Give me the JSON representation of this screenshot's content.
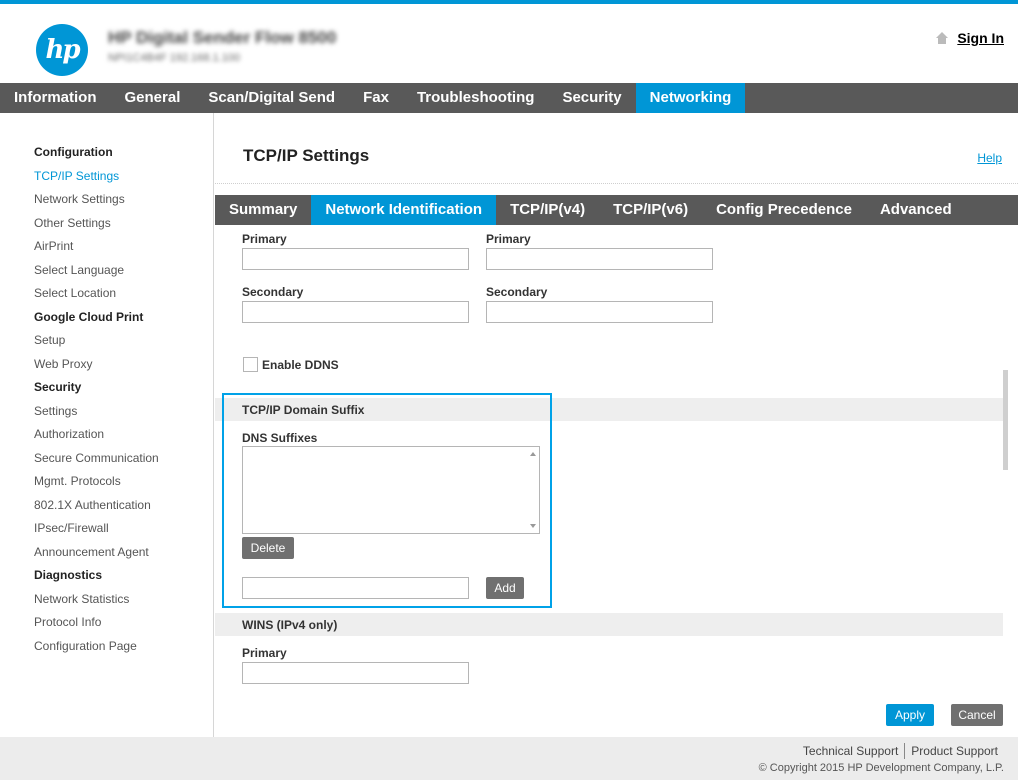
{
  "header": {
    "logo_text": "hp",
    "device_name": "HP Digital Sender Flow 8500",
    "device_subtitle": "NPI1C4B4F  192.168.1.100",
    "sign_in": "Sign In"
  },
  "main_nav": [
    {
      "label": "Information",
      "active": false
    },
    {
      "label": "General",
      "active": false
    },
    {
      "label": "Scan/Digital Send",
      "active": false
    },
    {
      "label": "Fax",
      "active": false
    },
    {
      "label": "Troubleshooting",
      "active": false
    },
    {
      "label": "Security",
      "active": false
    },
    {
      "label": "Networking",
      "active": true
    }
  ],
  "sidebar": {
    "configuration": {
      "heading": "Configuration",
      "items": [
        "TCP/IP Settings",
        "Network Settings",
        "Other Settings",
        "AirPrint",
        "Select Language",
        "Select Location"
      ]
    },
    "google_cloud_print": {
      "heading": "Google Cloud Print",
      "items": [
        "Setup",
        "Web Proxy"
      ]
    },
    "security": {
      "heading": "Security",
      "items": [
        "Settings",
        "Authorization",
        "Secure Communication",
        "Mgmt. Protocols",
        "802.1X Authentication",
        "IPsec/Firewall",
        "Announcement Agent"
      ]
    },
    "diagnostics": {
      "heading": "Diagnostics",
      "items": [
        "Network Statistics",
        "Protocol Info",
        "Configuration Page"
      ]
    }
  },
  "content": {
    "title": "TCP/IP Settings",
    "help": "Help",
    "tabs": [
      {
        "label": "Summary",
        "active": false
      },
      {
        "label": "Network Identification",
        "active": true
      },
      {
        "label": "TCP/IP(v4)",
        "active": false
      },
      {
        "label": "TCP/IP(v6)",
        "active": false
      },
      {
        "label": "Config Precedence",
        "active": false
      },
      {
        "label": "Advanced",
        "active": false
      }
    ],
    "dns": {
      "primary_label": "Primary",
      "secondary_label": "Secondary",
      "ipv4_primary": "",
      "ipv4_secondary": "",
      "ipv6_primary": "",
      "ipv6_secondary": ""
    },
    "enable_ddns": {
      "label": "Enable DDNS",
      "checked": false
    },
    "domain_suffix": {
      "section_title": "TCP/IP Domain Suffix",
      "dns_suffixes_label": "DNS Suffixes",
      "delete_button": "Delete",
      "add_input_value": "",
      "add_button": "Add"
    },
    "wins": {
      "section_title": "WINS (IPv4 only)",
      "primary_label": "Primary",
      "primary_value": ""
    },
    "apply_button": "Apply",
    "cancel_button": "Cancel"
  },
  "footer": {
    "technical_support": "Technical Support",
    "product_support": "Product Support",
    "copyright": "© Copyright 2015 HP Development Company, L.P."
  },
  "colors": {
    "accent": "#0096d6",
    "nav_bg": "#595959",
    "highlight": "#00a2e8",
    "footer_bg": "#ececec"
  }
}
